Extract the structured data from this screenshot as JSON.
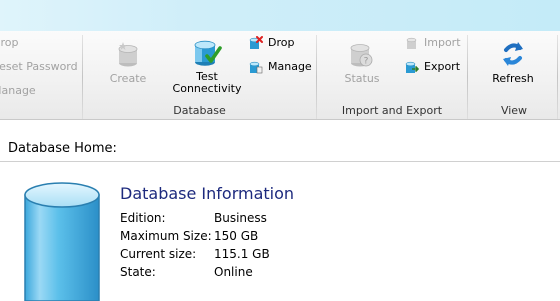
{
  "ribbon": {
    "left_group": {
      "items": [
        {
          "label": "Drop"
        },
        {
          "label": "Reset Password"
        },
        {
          "label": "Manage"
        }
      ]
    },
    "database_group": {
      "label": "Database",
      "create_label": "Create",
      "test_label_line1": "Test",
      "test_label_line2": "Connectivity",
      "drop_label": "Drop",
      "manage_label": "Manage"
    },
    "import_export_group": {
      "label": "Import and Export",
      "status_label": "Status",
      "import_label": "Import",
      "export_label": "Export"
    },
    "view_group": {
      "label": "View",
      "refresh_label": "Refresh"
    }
  },
  "main": {
    "home_title": "Database Home:",
    "db_info_title": "Database Information",
    "fields": [
      {
        "key": "Edition:",
        "value": "Business"
      },
      {
        "key": "Maximum Size:",
        "value": "150 GB"
      },
      {
        "key": "Current size:",
        "value": "115.1 GB"
      },
      {
        "key": "State:",
        "value": "Online"
      }
    ]
  }
}
